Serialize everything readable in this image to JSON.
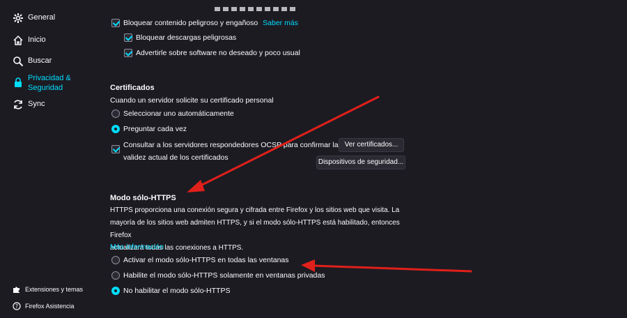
{
  "sidebar": {
    "items": [
      {
        "label": "General",
        "icon": "gear-icon"
      },
      {
        "label": "Inicio",
        "icon": "home-icon"
      },
      {
        "label": "Buscar",
        "icon": "search-icon"
      },
      {
        "label_line1": "Privacidad &",
        "label_line2": "Seguridad",
        "icon": "lock-icon"
      },
      {
        "label": "Sync",
        "icon": "sync-icon"
      }
    ],
    "footer": [
      {
        "label": "Extensiones y temas",
        "icon": "puzzle-icon"
      },
      {
        "label": "Firefox Asistencia",
        "icon": "help-icon"
      }
    ]
  },
  "security": {
    "block_dangerous": "Bloquear contenido peligroso y engañoso",
    "learn_more": "Saber más",
    "block_downloads": "Bloquear descargas peligrosas",
    "warn_unwanted": "Advertirle sobre software no deseado y poco usual"
  },
  "certificates": {
    "title": "Certificados",
    "description": "Cuando un servidor solicite su certificado personal",
    "option_auto": "Seleccionar uno automáticamente",
    "option_ask": "Preguntar cada vez",
    "ocsp_line1": "Consultar a los servidores respondedores OCSP para confirmar la",
    "ocsp_line2": "validez actual de los certificados",
    "view_certs_button": "Ver certificados...",
    "security_devices_button": "Dispositivos de seguridad..."
  },
  "https_mode": {
    "title": "Modo sólo-HTTPS",
    "desc_line1": "HTTPS proporciona una conexión segura y cifrada entre Firefox y los sitios web que visita. La",
    "desc_line2": "mayoría de los sitios web admiten HTTPS, y si el modo sólo-HTTPS está habilitado, entonces Firefox",
    "desc_line3": "actualizará todas las conexiones a HTTPS.",
    "more_info": "Más información",
    "option_all_windows": "Activar el modo sólo-HTTPS en todas las ventanas",
    "option_private_windows": "Habilite el modo sólo-HTTPS solamente en ventanas privadas",
    "option_disable": "No habilitar el modo sólo-HTTPS"
  },
  "colors": {
    "background": "#1c1b22",
    "accent": "#00ddff",
    "annotation_arrow": "#e0201a"
  }
}
